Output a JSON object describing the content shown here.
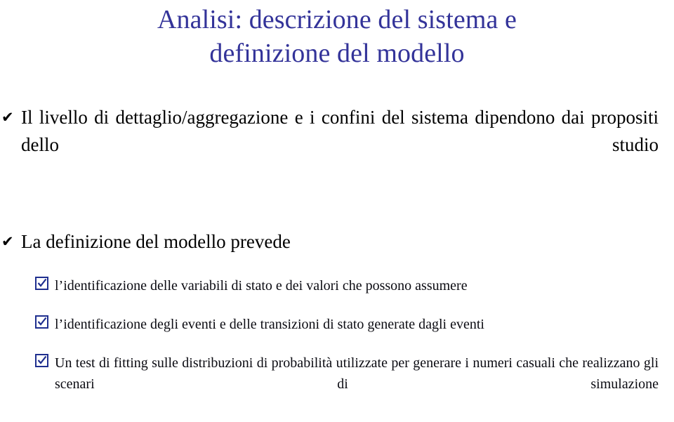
{
  "slide": {
    "background_color": "#ffffff",
    "title": {
      "color": "#333399",
      "line1": "Analisi: descrizione del sistema e",
      "line2": "definizione del modello"
    },
    "bullets_level1": [
      {
        "marker": "check-mark-bullet",
        "marker_glyph": "✔",
        "text": "Il livello di dettaglio/aggregazione e i confini del sistema dipendono dai propositi dello studio"
      },
      {
        "marker": "check-mark-bullet",
        "marker_glyph": "✔",
        "text": "La definizione del modello prevede"
      }
    ],
    "bullets_level2": [
      {
        "marker": "checked-box-bullet",
        "marker_color": "#1f2f8f",
        "text": "l’identificazione delle variabili di stato e dei valori che possono assumere"
      },
      {
        "marker": "checked-box-bullet",
        "marker_color": "#1f2f8f",
        "text": "l’identificazione degli eventi e delle transizioni di stato generate dagli eventi"
      },
      {
        "marker": "checked-box-bullet",
        "marker_color": "#1f2f8f",
        "text": "Un test di fitting sulle distribuzioni di probabilità utilizzate per generare i numeri casuali che realizzano gli scenari di simulazione"
      }
    ]
  }
}
